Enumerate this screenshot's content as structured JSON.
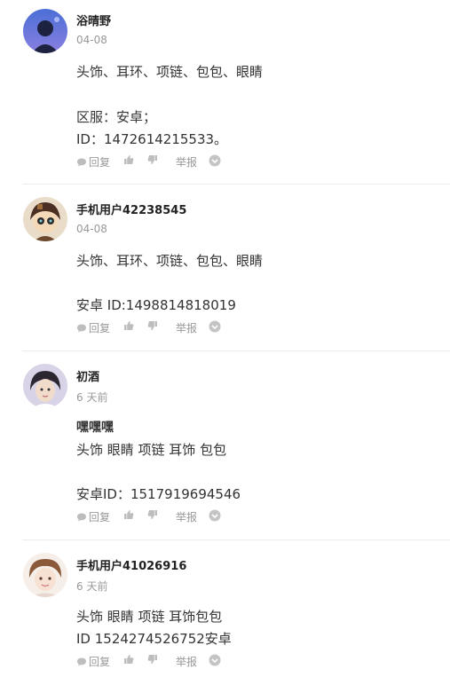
{
  "actions": {
    "reply": "回复",
    "report": "举报"
  },
  "comments": [
    {
      "username": "浴晴野",
      "time": "04-08",
      "title": "",
      "lines": [
        "头饰、耳环、项链、包包、眼睛",
        "",
        "区服：安卓；",
        "ID：1472614215533。"
      ]
    },
    {
      "username": "手机用户42238545",
      "time": "04-08",
      "title": "",
      "lines": [
        "头饰、耳环、项链、包包、眼睛",
        "",
        "安卓   ID:1498814818019"
      ]
    },
    {
      "username": "初酒",
      "time": "6 天前",
      "title": "嘿嘿嘿",
      "lines": [
        "头饰 眼睛 项链 耳饰 包包",
        "",
        "安卓ID：1517919694546"
      ]
    },
    {
      "username": "手机用户41026916",
      "time": "6 天前",
      "title": "",
      "lines": [
        "头饰 眼睛 项链 耳饰包包",
        "ID 1524274526752安卓"
      ]
    }
  ],
  "colors": {
    "username": "#222222",
    "meta": "#999999",
    "divider": "#ececec"
  }
}
